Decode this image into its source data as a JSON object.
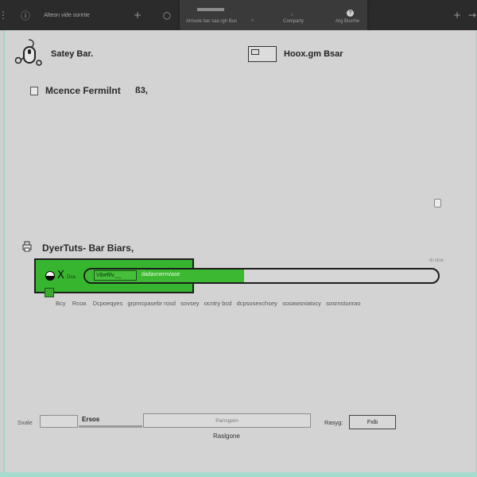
{
  "topbar": {
    "left_label": "Alteon vide sorirtie",
    "panel_tab_label": "Atrisole bar saa rgh Bus",
    "panel_tab_right": "Comparty",
    "right_label": "Arg Buxrhe"
  },
  "header": {
    "left_title": "Satey Bar.",
    "right_title": "Hoox.gm Bsar"
  },
  "section1": {
    "title": "Mcence Fermilnt",
    "suffix": "ß3,"
  },
  "section2": {
    "title": "DyerTuts- Bar Biars,"
  },
  "progress": {
    "fraction": 0.45,
    "inner_box_text": "Vibefilv.__",
    "caption": "dadaxnerm/ase",
    "panel_tiny": "Dxa",
    "right_note": "dr.uloe",
    "close_glyph": "X"
  },
  "description_row": "Bcy    Rcoa    Dcpoeqyes   grpmcpasebr rosd   sovsey   ocntry bcd   dcpsosexchsey   sosawsniatocy   sosrnstunrao",
  "bottom": {
    "left_label": "Sxale",
    "field_label": "Ersos",
    "center_placeholder": "Parrsgern",
    "center_caption": "Raslgone",
    "right_label": "Rasyg:",
    "right_button": "Fxib"
  }
}
